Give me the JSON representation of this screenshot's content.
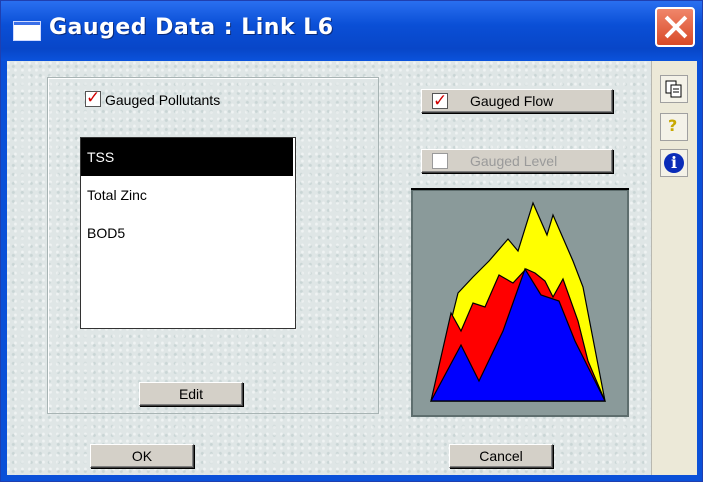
{
  "window": {
    "title": "Gauged Data : Link L6"
  },
  "left_panel": {
    "gauged_pollutants_label": "Gauged Pollutants",
    "gauged_pollutants_checked": true,
    "pollutants": [
      {
        "label": "TSS",
        "selected": true
      },
      {
        "label": "Total Zinc",
        "selected": false
      },
      {
        "label": "BOD5",
        "selected": false
      }
    ],
    "edit_label": "Edit"
  },
  "right_panel": {
    "gauged_flow_label": "Gauged Flow",
    "gauged_flow_checked": true,
    "gauged_level_label": "Gauged Level",
    "gauged_level_checked": false,
    "gauged_level_enabled": false
  },
  "toolbar": {
    "icons": [
      "copy-icon",
      "help-icon",
      "info-icon"
    ],
    "help_glyph": "?",
    "info_glyph": "i"
  },
  "footer": {
    "ok_label": "OK",
    "cancel_label": "Cancel"
  },
  "colors": {
    "blue_area": "#0000ff",
    "red_area": "#ff0000",
    "yellow_area": "#ffff00",
    "title_bar": "#0a50d8"
  }
}
